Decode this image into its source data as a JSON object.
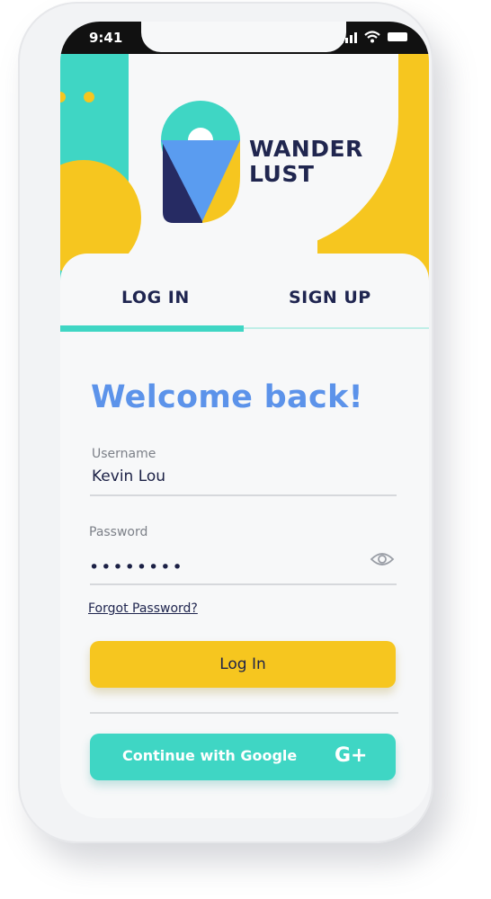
{
  "status_bar": {
    "time": "9:41"
  },
  "brand": {
    "line1": "WANDER",
    "line2": "LUST"
  },
  "tabs": [
    {
      "label": "LOG IN",
      "active": true
    },
    {
      "label": "SIGN UP",
      "active": false
    }
  ],
  "form": {
    "title": "Welcome back!",
    "username_label": "Username",
    "username_value": "Kevin Lou",
    "password_label": "Password",
    "password_value": "••••••••",
    "forgot_link": "Forgot Password?",
    "login_button": "Log In",
    "google_button": "Continue with Google",
    "google_icon_text": "G+"
  },
  "icons": [
    "signal-icon",
    "wifi-icon",
    "battery-icon",
    "location-pin-logo",
    "eye-icon",
    "google-plus-icon"
  ],
  "colors": {
    "teal": "#3fd6c4",
    "yellow": "#f6c61f",
    "navy": "#20264f",
    "blue_title": "#5c93ea",
    "pin_blue": "#5a9cf0"
  }
}
